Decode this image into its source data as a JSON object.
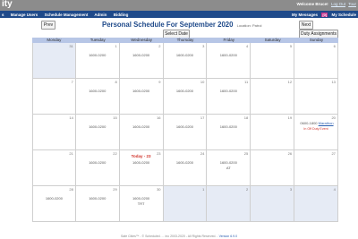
{
  "header": {
    "app_title": "ity",
    "welcome": "Welcome Bruce!",
    "links": [
      "Log Out",
      "Tour"
    ]
  },
  "nav": {
    "items": [
      "s",
      "Manage Users",
      "Schedule Management",
      "Admin",
      "Bidding"
    ],
    "my_messages": "My Messages",
    "messages_count": "[0]",
    "my_schedule": "My Schedule"
  },
  "page": {
    "title": "Personal Schedule For September 2020",
    "subtitle": "Location: Patrol",
    "prev": "Prev",
    "next": "Next",
    "select_date": "Select Date",
    "duty_assignments": "Duty Assignments"
  },
  "calendar": {
    "weekdays": [
      "Monday",
      "Tuesday",
      "Wednesday",
      "Thursday",
      "Friday",
      "Saturday",
      "Sunday"
    ],
    "weeks": [
      [
        {
          "day": "31",
          "shift": "",
          "shaded": true
        },
        {
          "day": "1",
          "shift": "1600-0200"
        },
        {
          "day": "2",
          "shift": "1600-0200"
        },
        {
          "day": "3",
          "shift": "1600-0200"
        },
        {
          "day": "4",
          "shift": "1600-0200"
        },
        {
          "day": "5",
          "shift": ""
        },
        {
          "day": "6",
          "shift": ""
        }
      ],
      [
        {
          "day": "7",
          "shift": ""
        },
        {
          "day": "8",
          "shift": "1600-0200"
        },
        {
          "day": "9",
          "shift": "1600-0200"
        },
        {
          "day": "10",
          "shift": "1600-0200"
        },
        {
          "day": "11",
          "shift": "1600-0200"
        },
        {
          "day": "12",
          "shift": ""
        },
        {
          "day": "13",
          "shift": ""
        }
      ],
      [
        {
          "day": "14",
          "shift": ""
        },
        {
          "day": "15",
          "shift": "1600-0200"
        },
        {
          "day": "16",
          "shift": "1600-0200"
        },
        {
          "day": "17",
          "shift": "1600-0200"
        },
        {
          "day": "18",
          "shift": "1600-0200"
        },
        {
          "day": "19",
          "shift": ""
        },
        {
          "day": "20",
          "shift": ""
        }
      ],
      [
        {
          "day": "21",
          "shift": ""
        },
        {
          "day": "22",
          "shift": "1600-0200"
        },
        {
          "day": "23",
          "shift": "1600-0200"
        },
        {
          "day": "24",
          "shift": "1600-0200"
        },
        {
          "day": "25",
          "shift": "1600-0200",
          "extra": "AT"
        },
        {
          "day": "26",
          "shift": ""
        },
        {
          "day": "27",
          "shift": ""
        }
      ],
      [
        {
          "day": "28",
          "shift": "1600-0200"
        },
        {
          "day": "29",
          "shift": "1600-0200"
        },
        {
          "day": "30",
          "shift": "1600-0200",
          "extra": "TRT"
        },
        {
          "day": "1",
          "shift": "",
          "shaded": true
        },
        {
          "day": "2",
          "shift": "",
          "shaded": true
        },
        {
          "day": "3",
          "shift": "",
          "shaded": true
        },
        {
          "day": "4",
          "shift": "",
          "shaded": true
        }
      ]
    ],
    "today_label": "Today - 23",
    "special_day20": {
      "time": "0600-1800",
      "link": "Marathon",
      "note": "In Off Duty Event"
    }
  },
  "footer": {
    "text": "Safe Cities™ - © Scheduled. ... Inc 2003-2020 - All Rights Reserved. -",
    "version": "Version 6.9.0"
  }
}
